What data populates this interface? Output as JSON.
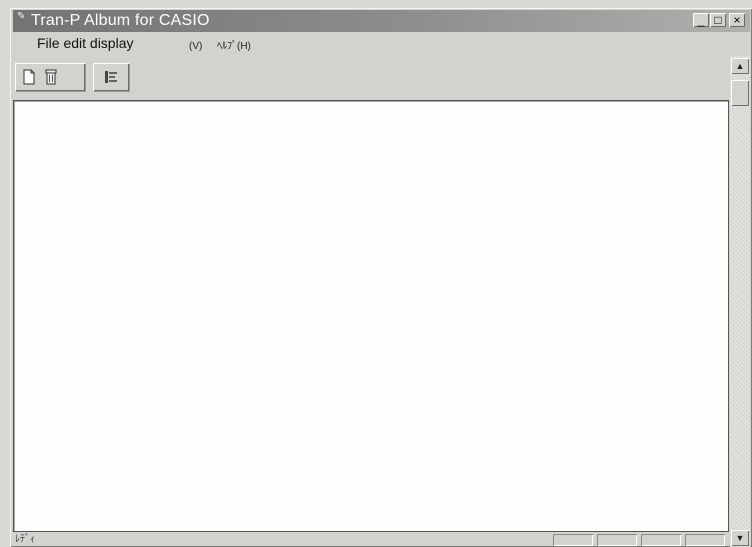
{
  "window": {
    "title": "Tran-P Album for CASIO",
    "controls": {
      "minimize": "_",
      "maximize": "□",
      "close": "×"
    }
  },
  "menu": {
    "items": [
      {
        "label": "File edit display"
      },
      {
        "label": "(V)"
      },
      {
        "label": "ﾍﾙﾌﾟ(H)"
      }
    ]
  },
  "toolbar": {
    "buttons": [
      {
        "icon": "new-page-icon"
      },
      {
        "icon": "delete-trash-icon"
      },
      {
        "icon": "list-view-icon"
      }
    ]
  },
  "status": {
    "text": "ﾚﾃﾞｨ"
  },
  "scrollbar": {
    "up": "▲",
    "down": "▼"
  },
  "colors": {
    "titlebar_start": "#737373",
    "titlebar_end": "#b0b0ae",
    "chrome": "#d4d2cc",
    "canvas": "#fdfdfc"
  }
}
